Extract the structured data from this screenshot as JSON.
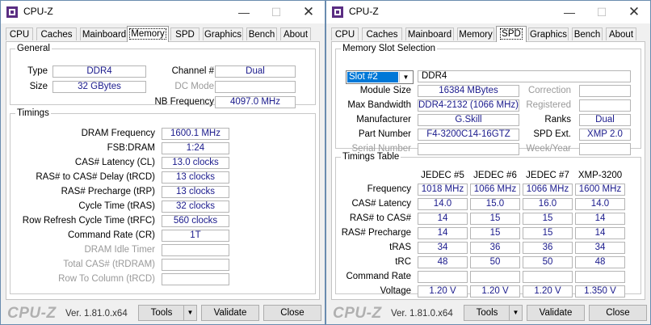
{
  "app": {
    "title": "CPU-Z",
    "window_controls": {
      "minimize": "—",
      "maximize": "☐",
      "close": "✕"
    }
  },
  "tabs": [
    "CPU",
    "Caches",
    "Mainboard",
    "Memory",
    "SPD",
    "Graphics",
    "Bench",
    "About"
  ],
  "memory": {
    "active_tab": "Memory",
    "general": {
      "legend": "General",
      "type_label": "Type",
      "type": "DDR4",
      "size_label": "Size",
      "size": "32 GBytes",
      "channel_label": "Channel #",
      "channel": "Dual",
      "dc_mode_label": "DC Mode",
      "dc_mode": "",
      "nb_freq_label": "NB Frequency",
      "nb_freq": "4097.0 MHz"
    },
    "timings": {
      "legend": "Timings",
      "rows": [
        {
          "label": "DRAM Frequency",
          "value": "1600.1 MHz",
          "dim": false
        },
        {
          "label": "FSB:DRAM",
          "value": "1:24",
          "dim": false
        },
        {
          "label": "CAS# Latency (CL)",
          "value": "13.0 clocks",
          "dim": false
        },
        {
          "label": "RAS# to CAS# Delay (tRCD)",
          "value": "13 clocks",
          "dim": false
        },
        {
          "label": "RAS# Precharge (tRP)",
          "value": "13 clocks",
          "dim": false
        },
        {
          "label": "Cycle Time (tRAS)",
          "value": "32 clocks",
          "dim": false
        },
        {
          "label": "Row Refresh Cycle Time (tRFC)",
          "value": "560 clocks",
          "dim": false
        },
        {
          "label": "Command Rate (CR)",
          "value": "1T",
          "dim": false
        },
        {
          "label": "DRAM Idle Timer",
          "value": "",
          "dim": true
        },
        {
          "label": "Total CAS# (tRDRAM)",
          "value": "",
          "dim": true
        },
        {
          "label": "Row To Column (tRCD)",
          "value": "",
          "dim": true
        }
      ]
    }
  },
  "spd": {
    "active_tab": "SPD",
    "slot_legend": "Memory Slot Selection",
    "slot_selected": "Slot #2",
    "module_type": "DDR4",
    "left_fields": [
      {
        "label": "Module Size",
        "value": "16384 MBytes",
        "dim": false
      },
      {
        "label": "Max Bandwidth",
        "value": "DDR4-2132 (1066 MHz)",
        "dim": false
      },
      {
        "label": "Manufacturer",
        "value": "G.Skill",
        "dim": false
      },
      {
        "label": "Part Number",
        "value": "F4-3200C14-16GTZ",
        "dim": false
      },
      {
        "label": "Serial Number",
        "value": "",
        "dim": true
      }
    ],
    "right_fields": [
      {
        "label": "Correction",
        "value": "",
        "dim": true
      },
      {
        "label": "Registered",
        "value": "",
        "dim": true
      },
      {
        "label": "Ranks",
        "value": "Dual",
        "dim": false
      },
      {
        "label": "SPD Ext.",
        "value": "XMP 2.0",
        "dim": false
      },
      {
        "label": "Week/Year",
        "value": "",
        "dim": true
      }
    ],
    "timings_legend": "Timings Table",
    "columns": [
      "JEDEC #5",
      "JEDEC #6",
      "JEDEC #7",
      "XMP-3200"
    ],
    "rows": [
      {
        "label": "Frequency",
        "values": [
          "1018 MHz",
          "1066 MHz",
          "1066 MHz",
          "1600 MHz"
        ]
      },
      {
        "label": "CAS# Latency",
        "values": [
          "14.0",
          "15.0",
          "16.0",
          "14.0"
        ]
      },
      {
        "label": "RAS# to CAS#",
        "values": [
          "14",
          "15",
          "15",
          "14"
        ]
      },
      {
        "label": "RAS# Precharge",
        "values": [
          "14",
          "15",
          "15",
          "14"
        ]
      },
      {
        "label": "tRAS",
        "values": [
          "34",
          "36",
          "36",
          "34"
        ]
      },
      {
        "label": "tRC",
        "values": [
          "48",
          "50",
          "50",
          "48"
        ]
      },
      {
        "label": "Command Rate",
        "values": [
          "",
          "",
          "",
          ""
        ]
      },
      {
        "label": "Voltage",
        "values": [
          "1.20 V",
          "1.20 V",
          "1.20 V",
          "1.350 V"
        ]
      }
    ]
  },
  "footer": {
    "brand": "CPU-Z",
    "version": "Ver. 1.81.0.x64",
    "tools_label": "Tools",
    "dropdown_arrow": "▼",
    "validate_label": "Validate",
    "close_label": "Close"
  }
}
